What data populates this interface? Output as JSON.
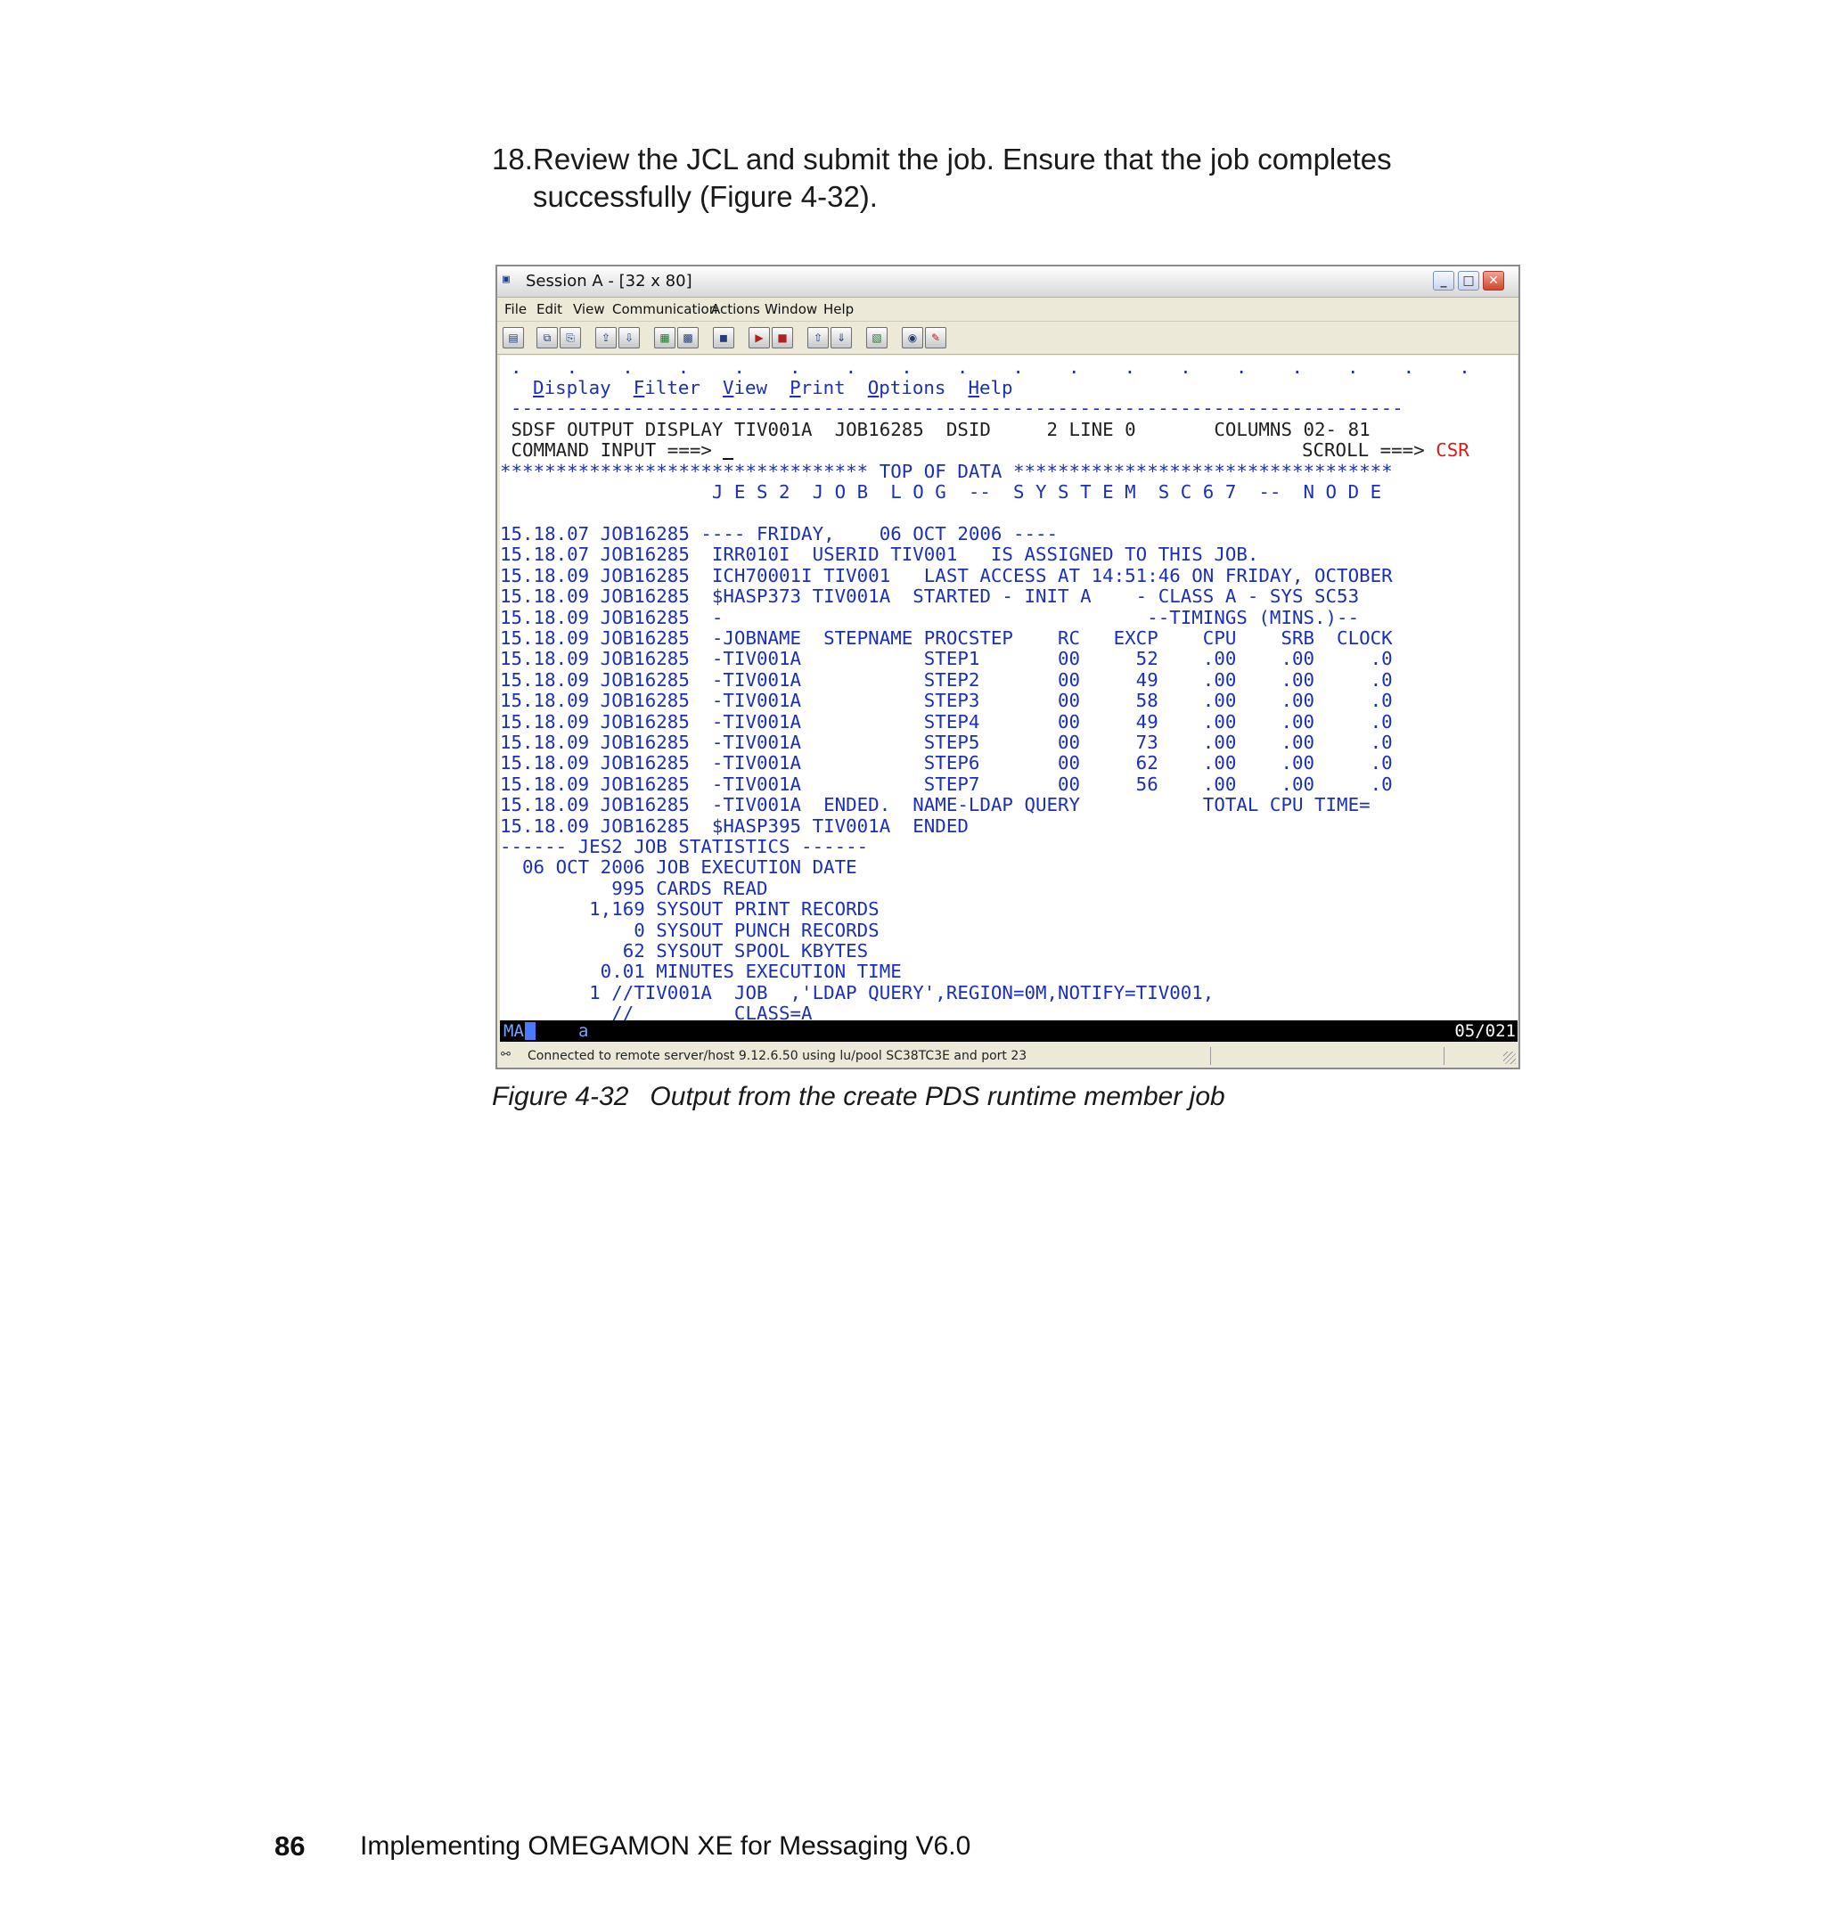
{
  "step": {
    "number": "18.",
    "line1": "Review the JCL and submit the job. Ensure that the job completes",
    "line2": "successfully (Figure 4-32)."
  },
  "window": {
    "title": "Session A - [32 x 80]",
    "menu": [
      "File",
      "Edit",
      "View",
      "Communication",
      "Actions",
      "Window",
      "Help"
    ],
    "toolbar_icons": [
      "print-screen-icon",
      "copy-icon",
      "paste-icon",
      "send-icon",
      "receive-icon",
      "display-icon",
      "keyboard-icon",
      "record-icon",
      "macro-play-icon",
      "macro-stop-icon",
      "transfer-send-icon",
      "transfer-receive-icon",
      "clipboard-icon",
      "web-icon",
      "edit-icon"
    ]
  },
  "terminal": {
    "dots": ".    .    .    .    .    .    .    .    .    .    .    .    .    .    .    .    .    .    .    .    .    .    .    .    .    .    .",
    "menu": [
      {
        "hot": "D",
        "rest": "isplay"
      },
      {
        "hot": "F",
        "rest": "ilter"
      },
      {
        "hot": "V",
        "rest": "iew"
      },
      {
        "hot": "P",
        "rest": "rint"
      },
      {
        "hot": "O",
        "rest": "ptions"
      },
      {
        "hot": "H",
        "rest": "elp"
      }
    ],
    "separator": "--------------------------------------------------------------------------------",
    "header1": " SDSF OUTPUT DISPLAY TIV001A  JOB16285  DSID     2 LINE 0       COLUMNS 02- 81",
    "command_label": " COMMAND INPUT ===> ",
    "scroll_label": "SCROLL ===> ",
    "scroll_value": "CSR",
    "top_of_data": "********************************* TOP OF DATA **********************************",
    "banner": "                   J E S 2  J O B  L O G  --  S Y S T E M  S C 6 7  --  N O D E",
    "log_lines": [
      "15.18.07 JOB16285 ---- FRIDAY,    06 OCT 2006 ----",
      "15.18.07 JOB16285  IRR010I  USERID TIV001   IS ASSIGNED TO THIS JOB.",
      "15.18.09 JOB16285  ICH70001I TIV001   LAST ACCESS AT 14:51:46 ON FRIDAY, OCTOBER",
      "15.18.09 JOB16285  $HASP373 TIV001A  STARTED - INIT A    - CLASS A - SYS SC53",
      "15.18.09 JOB16285  -                                      --TIMINGS (MINS.)--",
      "15.18.09 JOB16285  -JOBNAME  STEPNAME PROCSTEP    RC   EXCP    CPU    SRB  CLOCK",
      "15.18.09 JOB16285  -TIV001A           STEP1       00     52    .00    .00     .0",
      "15.18.09 JOB16285  -TIV001A           STEP2       00     49    .00    .00     .0",
      "15.18.09 JOB16285  -TIV001A           STEP3       00     58    .00    .00     .0",
      "15.18.09 JOB16285  -TIV001A           STEP4       00     49    .00    .00     .0",
      "15.18.09 JOB16285  -TIV001A           STEP5       00     73    .00    .00     .0",
      "15.18.09 JOB16285  -TIV001A           STEP6       00     62    .00    .00     .0",
      "15.18.09 JOB16285  -TIV001A           STEP7       00     56    .00    .00     .0",
      "15.18.09 JOB16285  -TIV001A  ENDED.  NAME-LDAP QUERY           TOTAL CPU TIME=",
      "15.18.09 JOB16285  $HASP395 TIV001A  ENDED",
      "------ JES2 JOB STATISTICS ------",
      "  06 OCT 2006 JOB EXECUTION DATE",
      "          995 CARDS READ",
      "        1,169 SYSOUT PRINT RECORDS",
      "            0 SYSOUT PUNCH RECORDS",
      "           62 SYSOUT SPOOL KBYTES",
      "         0.01 MINUTES EXECUTION TIME",
      "        1 //TIV001A  JOB  ,'LDAP QUERY',REGION=0M,NOTIFY=TIV001,",
      "          //         CLASS=A"
    ]
  },
  "oia": {
    "mode": "MA",
    "indicator": "a",
    "cursor_pos": "05/021"
  },
  "statusbar": {
    "message": "Connected to remote server/host 9.12.6.50 using lu/pool SC38TC3E and port 23"
  },
  "caption": {
    "figure": "Figure 4-32",
    "text": "Output from the create PDS runtime member job"
  },
  "footer": {
    "page_number": "86",
    "title": "Implementing OMEGAMON XE for Messaging V6.0"
  }
}
